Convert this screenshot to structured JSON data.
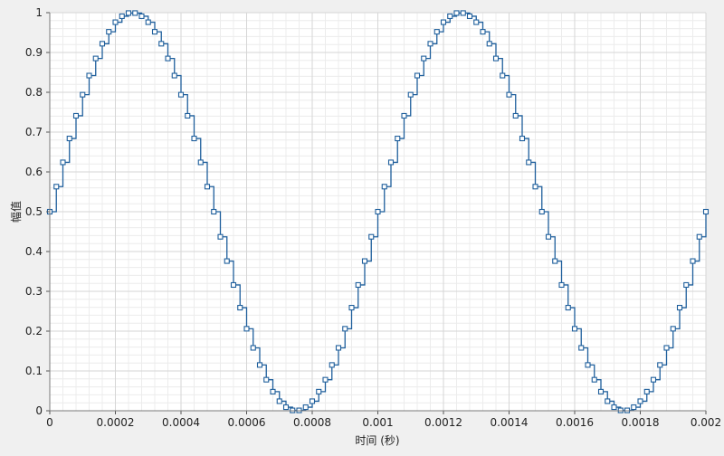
{
  "chart_data": {
    "type": "line",
    "title": "",
    "xlabel": "时间 (秒)",
    "ylabel": "幅值",
    "xlim": [
      0,
      0.002
    ],
    "ylim": [
      0,
      1
    ],
    "x_ticks": [
      0,
      0.0002,
      0.0004,
      0.0006,
      0.0008,
      0.001,
      0.0012,
      0.0014,
      0.0016,
      0.0018,
      0.002
    ],
    "x_tick_labels": [
      "0",
      "0.0002",
      "0.0004",
      "0.0006",
      "0.0008",
      "0.001",
      "0.0012",
      "0.0014",
      "0.0016",
      "0.0018",
      "0.002"
    ],
    "y_ticks": [
      0,
      0.1,
      0.2,
      0.3,
      0.4,
      0.5,
      0.6,
      0.7,
      0.8,
      0.9,
      1
    ],
    "y_tick_labels": [
      "0",
      "0.1",
      "0.2",
      "0.3",
      "0.4",
      "0.5",
      "0.6",
      "0.7",
      "0.8",
      "0.9",
      "1"
    ],
    "grid": true,
    "series": [
      {
        "style": "stairs-with-square-markers",
        "color": "#1f5f9c",
        "x": [
          0,
          2e-05,
          4e-05,
          6e-05,
          8e-05,
          0.0001,
          0.00012,
          0.00014,
          0.00016,
          0.00018,
          0.0002,
          0.00022,
          0.00024,
          0.00026,
          0.00028,
          0.0003,
          0.00032,
          0.00034,
          0.00036,
          0.00038,
          0.0004,
          0.00042,
          0.00044,
          0.00046,
          0.00048,
          0.0005,
          0.00052,
          0.00054,
          0.00056,
          0.00058,
          0.0006,
          0.00062,
          0.00064,
          0.00066,
          0.00068,
          0.0007,
          0.00072,
          0.00074,
          0.00076,
          0.00078,
          0.0008,
          0.00082,
          0.00084,
          0.00086,
          0.00088,
          0.0009,
          0.00092,
          0.00094,
          0.00096,
          0.00098,
          0.001,
          0.00102,
          0.00104,
          0.00106,
          0.00108,
          0.0011,
          0.00112,
          0.00114,
          0.00116,
          0.00118,
          0.0012,
          0.00122,
          0.00124,
          0.00126,
          0.00128,
          0.0013,
          0.00132,
          0.00134,
          0.00136,
          0.00138,
          0.0014,
          0.00142,
          0.00144,
          0.00146,
          0.00148,
          0.0015,
          0.00152,
          0.00154,
          0.00156,
          0.00158,
          0.0016,
          0.00162,
          0.00164,
          0.00166,
          0.00168,
          0.0017,
          0.00172,
          0.00174,
          0.00176,
          0.00178,
          0.0018,
          0.00182,
          0.00184,
          0.00186,
          0.00188,
          0.0019,
          0.00192,
          0.00194,
          0.00196,
          0.00198,
          0.002
        ],
        "y": [
          0.5,
          0.563,
          0.624,
          0.684,
          0.741,
          0.794,
          0.842,
          0.885,
          0.922,
          0.952,
          0.976,
          0.991,
          0.999,
          0.999,
          0.991,
          0.976,
          0.952,
          0.922,
          0.885,
          0.842,
          0.794,
          0.741,
          0.684,
          0.624,
          0.563,
          0.5,
          0.437,
          0.376,
          0.316,
          0.259,
          0.206,
          0.158,
          0.115,
          0.078,
          0.048,
          0.024,
          0.009,
          0.001,
          0.001,
          0.009,
          0.024,
          0.048,
          0.078,
          0.115,
          0.158,
          0.206,
          0.259,
          0.316,
          0.376,
          0.437,
          0.5,
          0.563,
          0.624,
          0.684,
          0.741,
          0.794,
          0.842,
          0.885,
          0.922,
          0.952,
          0.976,
          0.991,
          0.999,
          0.999,
          0.991,
          0.976,
          0.952,
          0.922,
          0.885,
          0.842,
          0.794,
          0.741,
          0.684,
          0.624,
          0.563,
          0.5,
          0.437,
          0.376,
          0.316,
          0.259,
          0.206,
          0.158,
          0.115,
          0.078,
          0.048,
          0.024,
          0.009,
          0.001,
          0.001,
          0.009,
          0.024,
          0.048,
          0.078,
          0.115,
          0.158,
          0.206,
          0.259,
          0.316,
          0.376,
          0.437,
          0.5
        ]
      }
    ]
  }
}
